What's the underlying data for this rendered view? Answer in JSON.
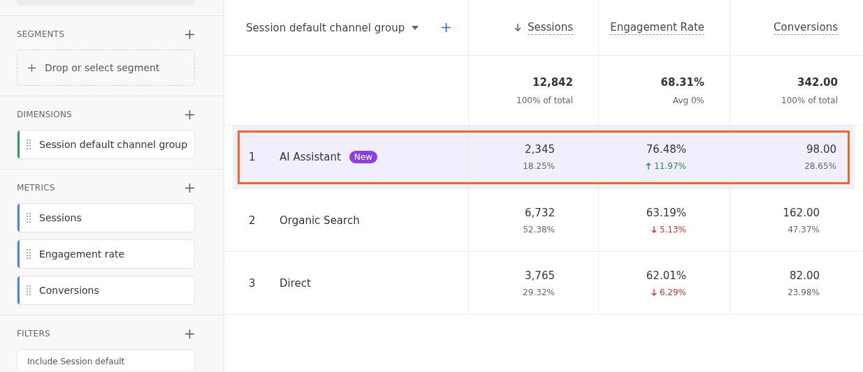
{
  "sidebar": {
    "sections": [
      {
        "title": "SEGMENTS",
        "kind": "dropzone",
        "placeholder": "Drop or select segment"
      },
      {
        "title": "DIMENSIONS",
        "kind": "chips",
        "color": "#2e9e5b",
        "items": [
          "Session default channel group"
        ]
      },
      {
        "title": "METRICS",
        "kind": "chips",
        "color": "#4a86e8",
        "items": [
          "Sessions",
          "Engagement rate",
          "Conversions"
        ]
      },
      {
        "title": "FILTERS",
        "kind": "filter",
        "items": [
          "Include  Session default"
        ]
      }
    ]
  },
  "table": {
    "dimension_column": "Session default channel group",
    "columns": [
      {
        "label": "Sessions",
        "sorted": true
      },
      {
        "label": "Engagement Rate",
        "sorted": false
      },
      {
        "label": "Conversions",
        "sorted": false
      }
    ],
    "totals": [
      {
        "value": "12,842",
        "sub": "100% of total"
      },
      {
        "value": "68.31%",
        "sub": "Avg 0%"
      },
      {
        "value": "342.00",
        "sub": "100% of total"
      }
    ],
    "rows": [
      {
        "rank": "1",
        "name": "AI Assistant",
        "badge": "New",
        "highlighted": true,
        "cells": [
          {
            "value": "2,345",
            "sub": "18.25%"
          },
          {
            "value": "76.48%",
            "sub": "11.97%",
            "kind": "up"
          },
          {
            "value": "98.00",
            "sub": "28.65%"
          }
        ]
      },
      {
        "rank": "2",
        "name": "Organic Search",
        "highlighted": false,
        "cells": [
          {
            "value": "6,732",
            "sub": "52.38%"
          },
          {
            "value": "63.19%",
            "sub": "5.13%",
            "kind": "down"
          },
          {
            "value": "162.00",
            "sub": "47.37%"
          }
        ]
      },
      {
        "rank": "3",
        "name": "Direct",
        "highlighted": false,
        "cells": [
          {
            "value": "3,765",
            "sub": "29.32%"
          },
          {
            "value": "62.01%",
            "sub": "6.29%",
            "kind": "down"
          },
          {
            "value": "82.00",
            "sub": "23.98%"
          }
        ]
      }
    ]
  }
}
